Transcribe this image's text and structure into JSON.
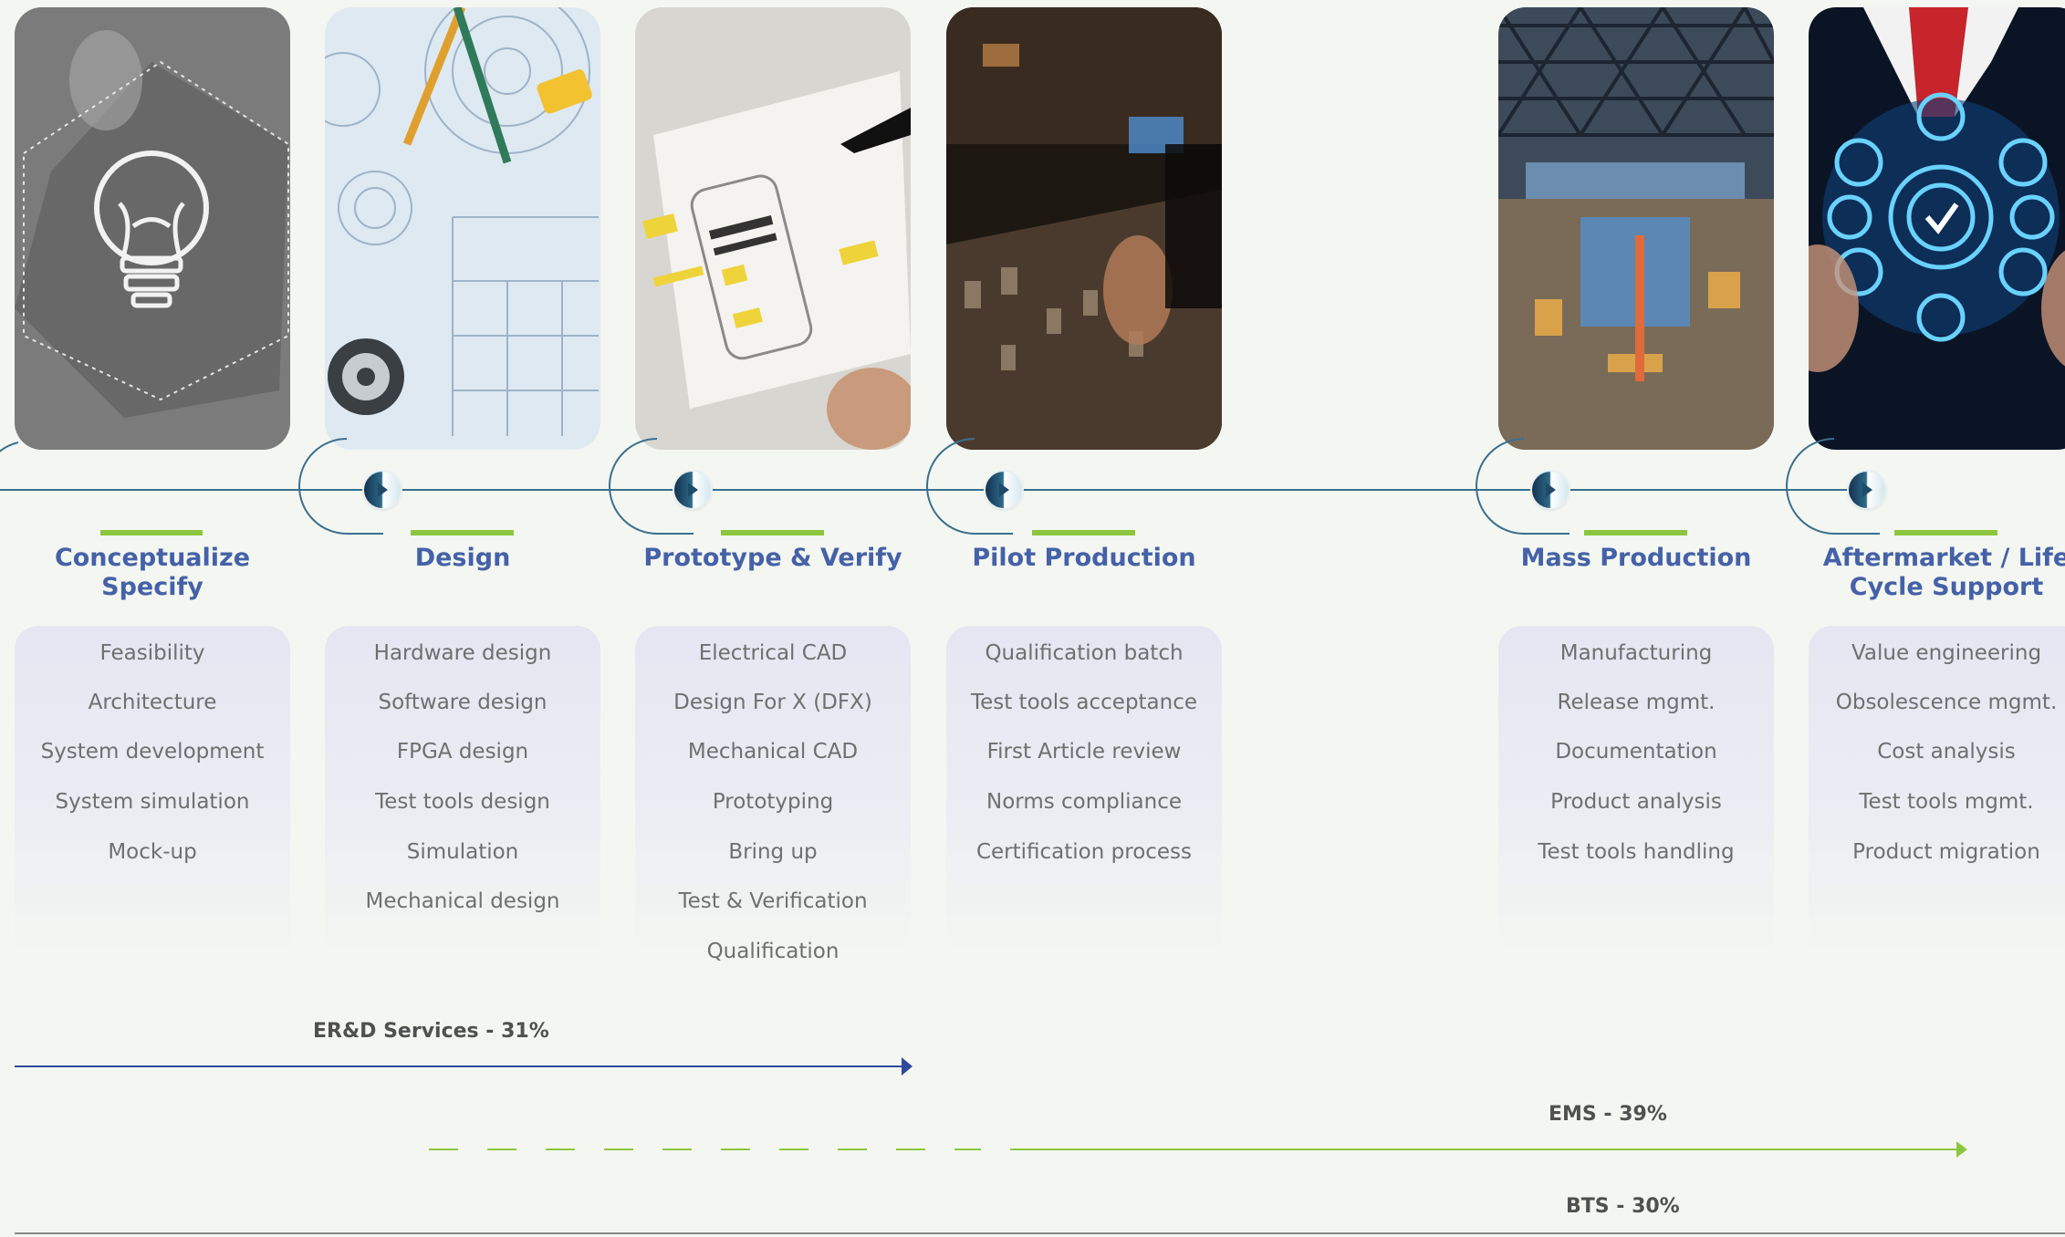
{
  "stages": [
    {
      "id": "conceptualize",
      "title": "Conceptualize\nSpecify",
      "photo": "lightbulb-sketch-photo",
      "tasks": [
        "Feasibility",
        "Architecture",
        "System development",
        "System simulation",
        "Mock-up"
      ]
    },
    {
      "id": "design",
      "title": "Design",
      "photo": "blueprint-drawing-photo",
      "tasks": [
        "Hardware design",
        "Software design",
        "FPGA design",
        "Test tools design",
        "Simulation",
        "Mechanical design"
      ]
    },
    {
      "id": "prototype",
      "title": "Prototype & Verify",
      "photo": "wireframe-sketch-photo",
      "tasks": [
        "Electrical CAD",
        "Design For X (DFX)",
        "Mechanical CAD",
        "Prototyping",
        "Bring up",
        "Test & Verification",
        "Qualification"
      ]
    },
    {
      "id": "pilot",
      "title": "Pilot Production",
      "photo": "control-panel-photo",
      "tasks": [
        "Qualification batch",
        "Test tools acceptance",
        "First Article review",
        "Norms compliance",
        "Certification process"
      ]
    },
    {
      "id": "mass",
      "title": "Mass Production",
      "photo": "factory-floor-photo",
      "tasks": [
        "Manufacturing",
        "Release mgmt.",
        "Documentation",
        "Product analysis",
        "Test tools handling"
      ]
    },
    {
      "id": "aftermarket",
      "title": "Aftermarket / Life\nCycle Support",
      "photo": "digital-gear-icons-photo",
      "tasks": [
        "Value engineering",
        "Obsolescence mgmt.",
        "Cost analysis",
        "Test tools mgmt.",
        "Product migration"
      ]
    }
  ],
  "service_lines": [
    {
      "id": "erd",
      "label": "ER&D Services  - 31%",
      "color": "#2e4a9a"
    },
    {
      "id": "ems",
      "label": "EMS - 39%",
      "color": "#8cc63f"
    },
    {
      "id": "bts",
      "label": "BTS - 30%",
      "color": "#8a8a8a"
    }
  ],
  "colors": {
    "accent_green": "#8cc63f",
    "title_blue": "#4561a8",
    "connector": "#3b6f8f"
  }
}
